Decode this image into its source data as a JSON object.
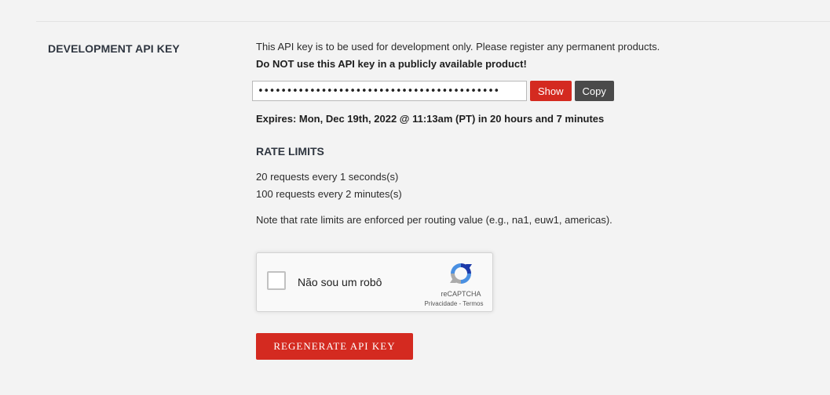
{
  "section": {
    "label": "DEVELOPMENT API KEY"
  },
  "api_key": {
    "description": "This API key is to be used for development only. Please register any permanent products.",
    "warning": "Do NOT use this API key in a publicly available product!",
    "masked_value": "••••••••••••••••••••••••••••••••••••••••••",
    "show_label": "Show",
    "copy_label": "Copy",
    "expires": "Expires: Mon, Dec 19th, 2022 @ 11:13am (PT) in 20 hours and 7 minutes"
  },
  "rate_limits": {
    "heading": "RATE LIMITS",
    "lines": [
      "20 requests every 1 seconds(s)",
      "100 requests every 2 minutes(s)"
    ],
    "note": "Note that rate limits are enforced per routing value (e.g., na1, euw1, americas)."
  },
  "recaptcha": {
    "label": "Não sou um robô",
    "brand": "reCAPTCHA",
    "privacy": "Privacidade",
    "separator": " - ",
    "terms": "Termos",
    "logo_icon": "recaptcha-logo-icon"
  },
  "actions": {
    "regenerate_label": "REGENERATE API KEY"
  },
  "colors": {
    "accent_red": "#d42a20",
    "copy_gray": "#4a4a4a",
    "background": "#f3f3f3"
  }
}
